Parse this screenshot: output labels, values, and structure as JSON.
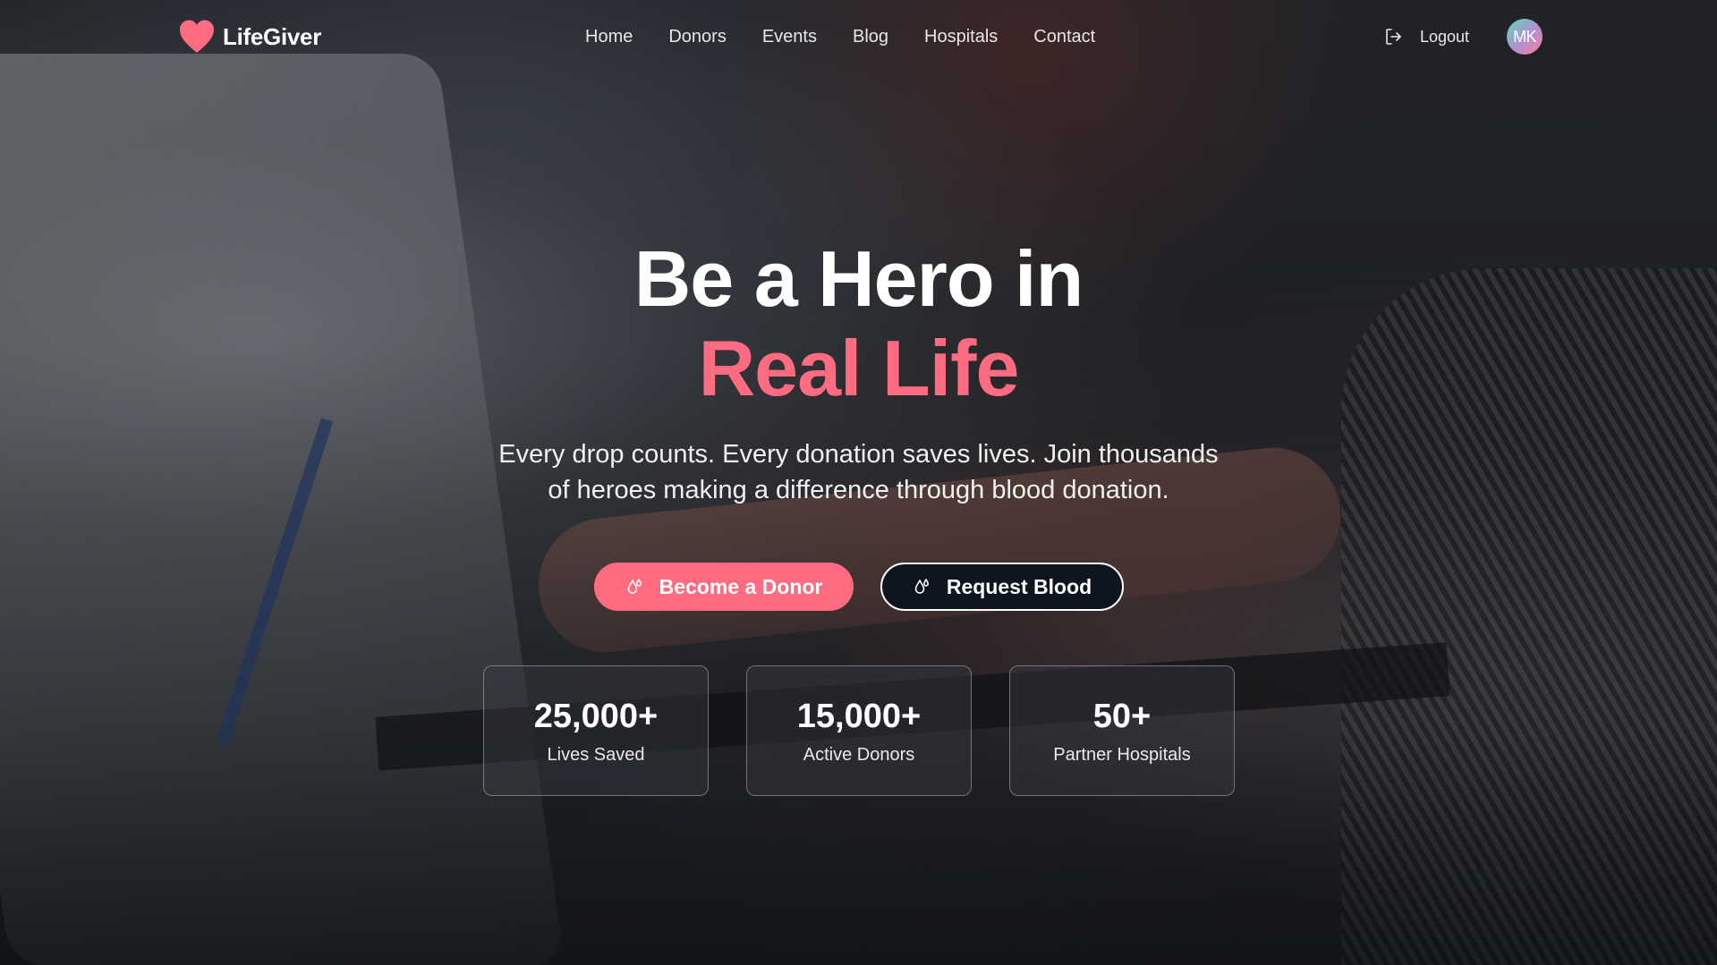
{
  "brand": {
    "name": "LifeGiver",
    "icon": "heart-icon",
    "accent_color": "#ff6b81"
  },
  "nav": {
    "links": [
      "Home",
      "Donors",
      "Events",
      "Blog",
      "Hospitals",
      "Contact"
    ],
    "logout_label": "Logout",
    "logout_icon": "logout-icon",
    "avatar_initials": "MK"
  },
  "hero": {
    "title_line1": "Be a Hero in",
    "title_line2": "Real Life",
    "subtitle": "Every drop counts. Every donation saves lives. Join thousands of heroes making a difference through blood donation.",
    "primary_button": "Become a Donor",
    "secondary_button": "Request Blood",
    "button_icon": "blood-drop-icon"
  },
  "stats": [
    {
      "value": "25,000+",
      "label": "Lives Saved"
    },
    {
      "value": "15,000+",
      "label": "Active Donors"
    },
    {
      "value": "50+",
      "label": "Partner Hospitals"
    }
  ]
}
